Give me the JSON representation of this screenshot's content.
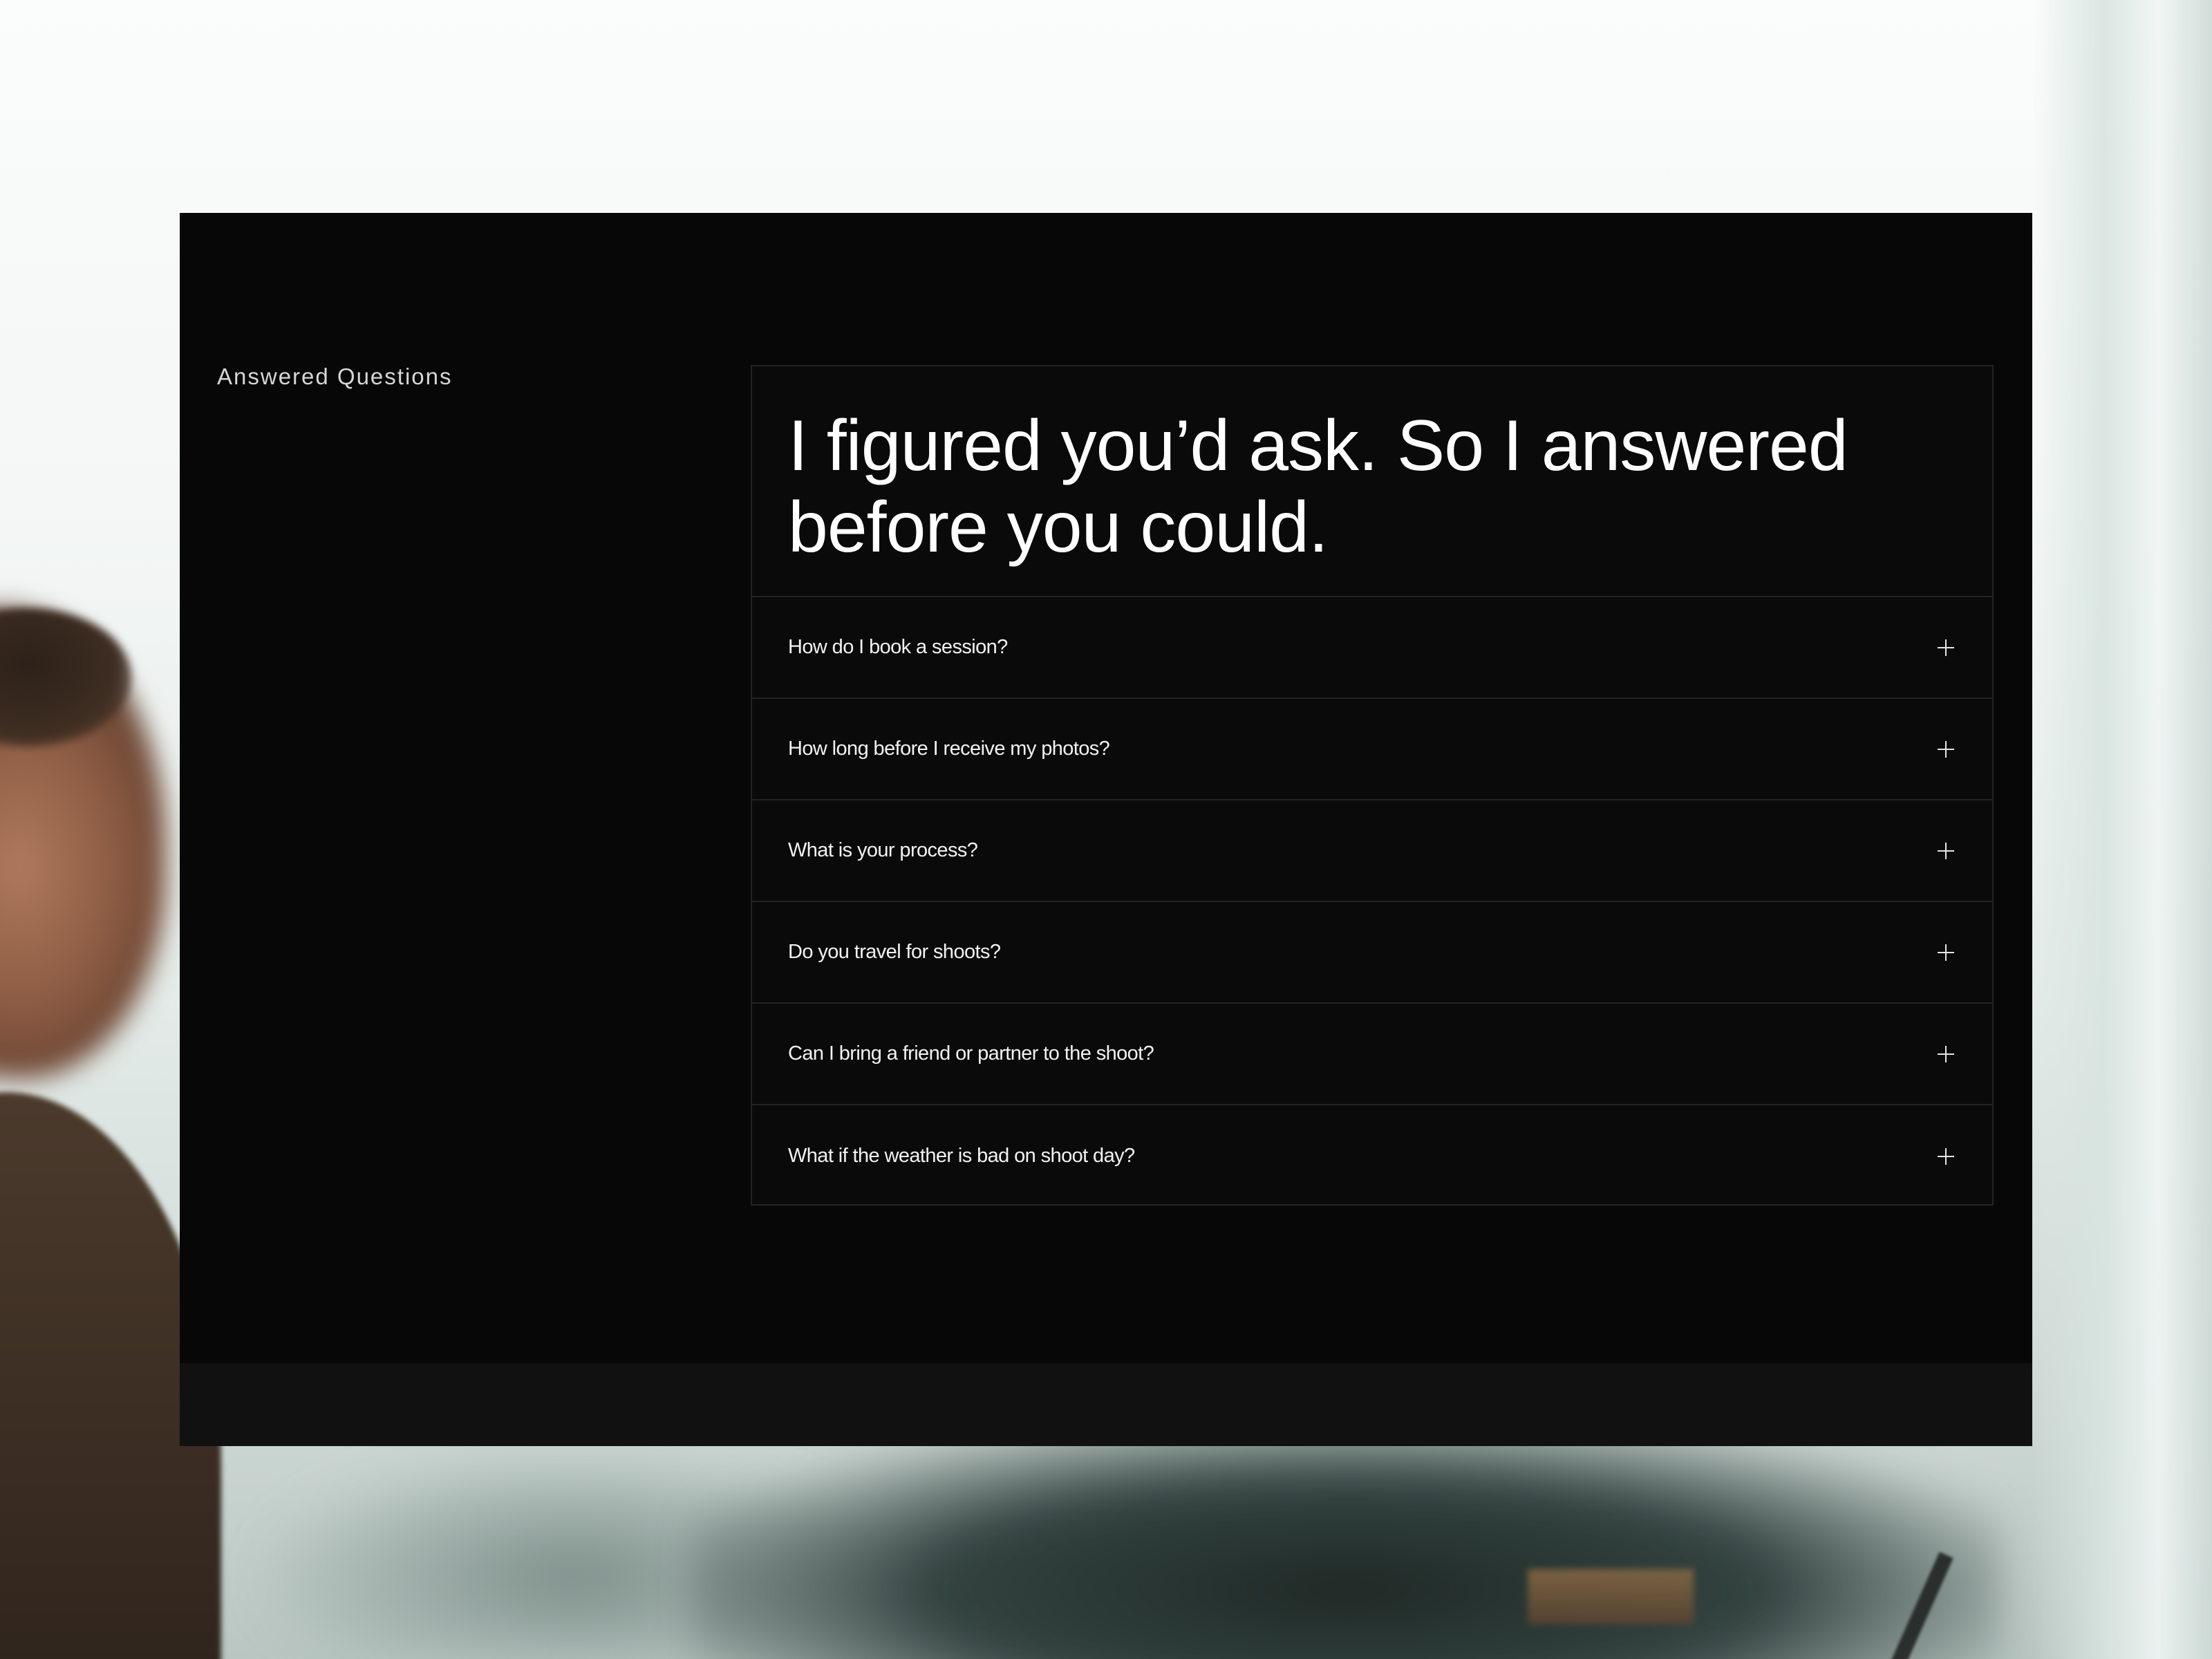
{
  "section_label": "Answered Questions",
  "heading": {
    "line1": "I figured you’d ask. So I answered",
    "line2": "before you could."
  },
  "faq": [
    {
      "question": "How do I book a session?",
      "icon": "plus-icon"
    },
    {
      "question": "How long before I receive my photos?",
      "icon": "plus-icon"
    },
    {
      "question": "What is your process?",
      "icon": "plus-icon"
    },
    {
      "question": "Do you travel for shoots?",
      "icon": "plus-icon"
    },
    {
      "question": "Can I bring a friend or partner to the shoot?",
      "icon": "plus-icon"
    },
    {
      "question": "What if the weather is bad on shoot day?",
      "icon": "plus-icon"
    }
  ],
  "colors": {
    "panel_background": "#070707",
    "footer_background": "#111111",
    "divider": "#232323",
    "text": "#ffffff"
  }
}
